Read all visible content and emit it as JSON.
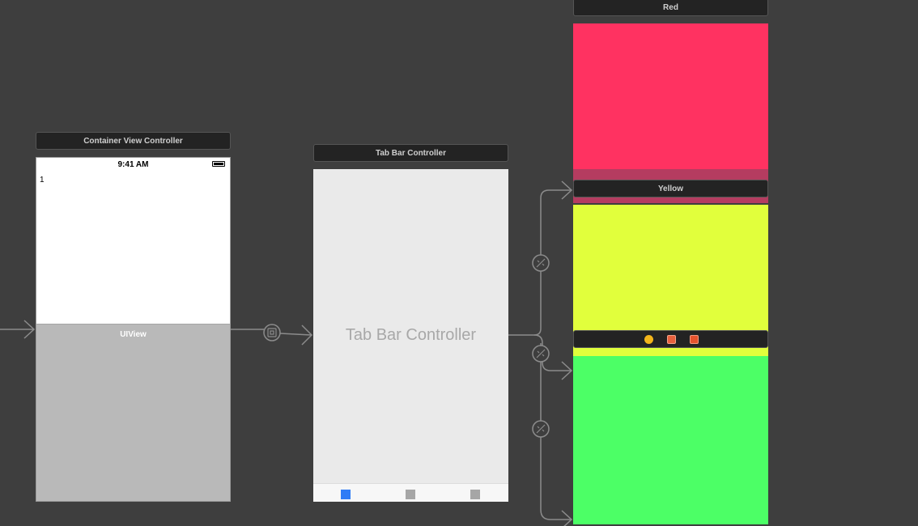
{
  "scenes": {
    "container": {
      "title": "Container View Controller",
      "status_time": "9:41 AM",
      "label_text": "1",
      "uiview_label": "UIView"
    },
    "tab_bar": {
      "title": "Tab Bar Controller",
      "center_label": "Tab Bar Controller",
      "tab_items": [
        "tab-item-1",
        "tab-item-2",
        "tab-item-3"
      ]
    },
    "red": {
      "title": "Red",
      "color": "#ff3261"
    },
    "yellow": {
      "title": "Yellow",
      "color": "#e1ff3c"
    },
    "green": {
      "color": "#4cff66",
      "dock_icons": [
        "first-responder-icon",
        "view-controller-icon",
        "exit-icon"
      ]
    }
  },
  "colors": {
    "canvas": "#3e3e3e",
    "segue_line": "#8a8a8a",
    "tab_selected": "#2f7cf6",
    "tab_unselected": "#a6a6a6"
  }
}
